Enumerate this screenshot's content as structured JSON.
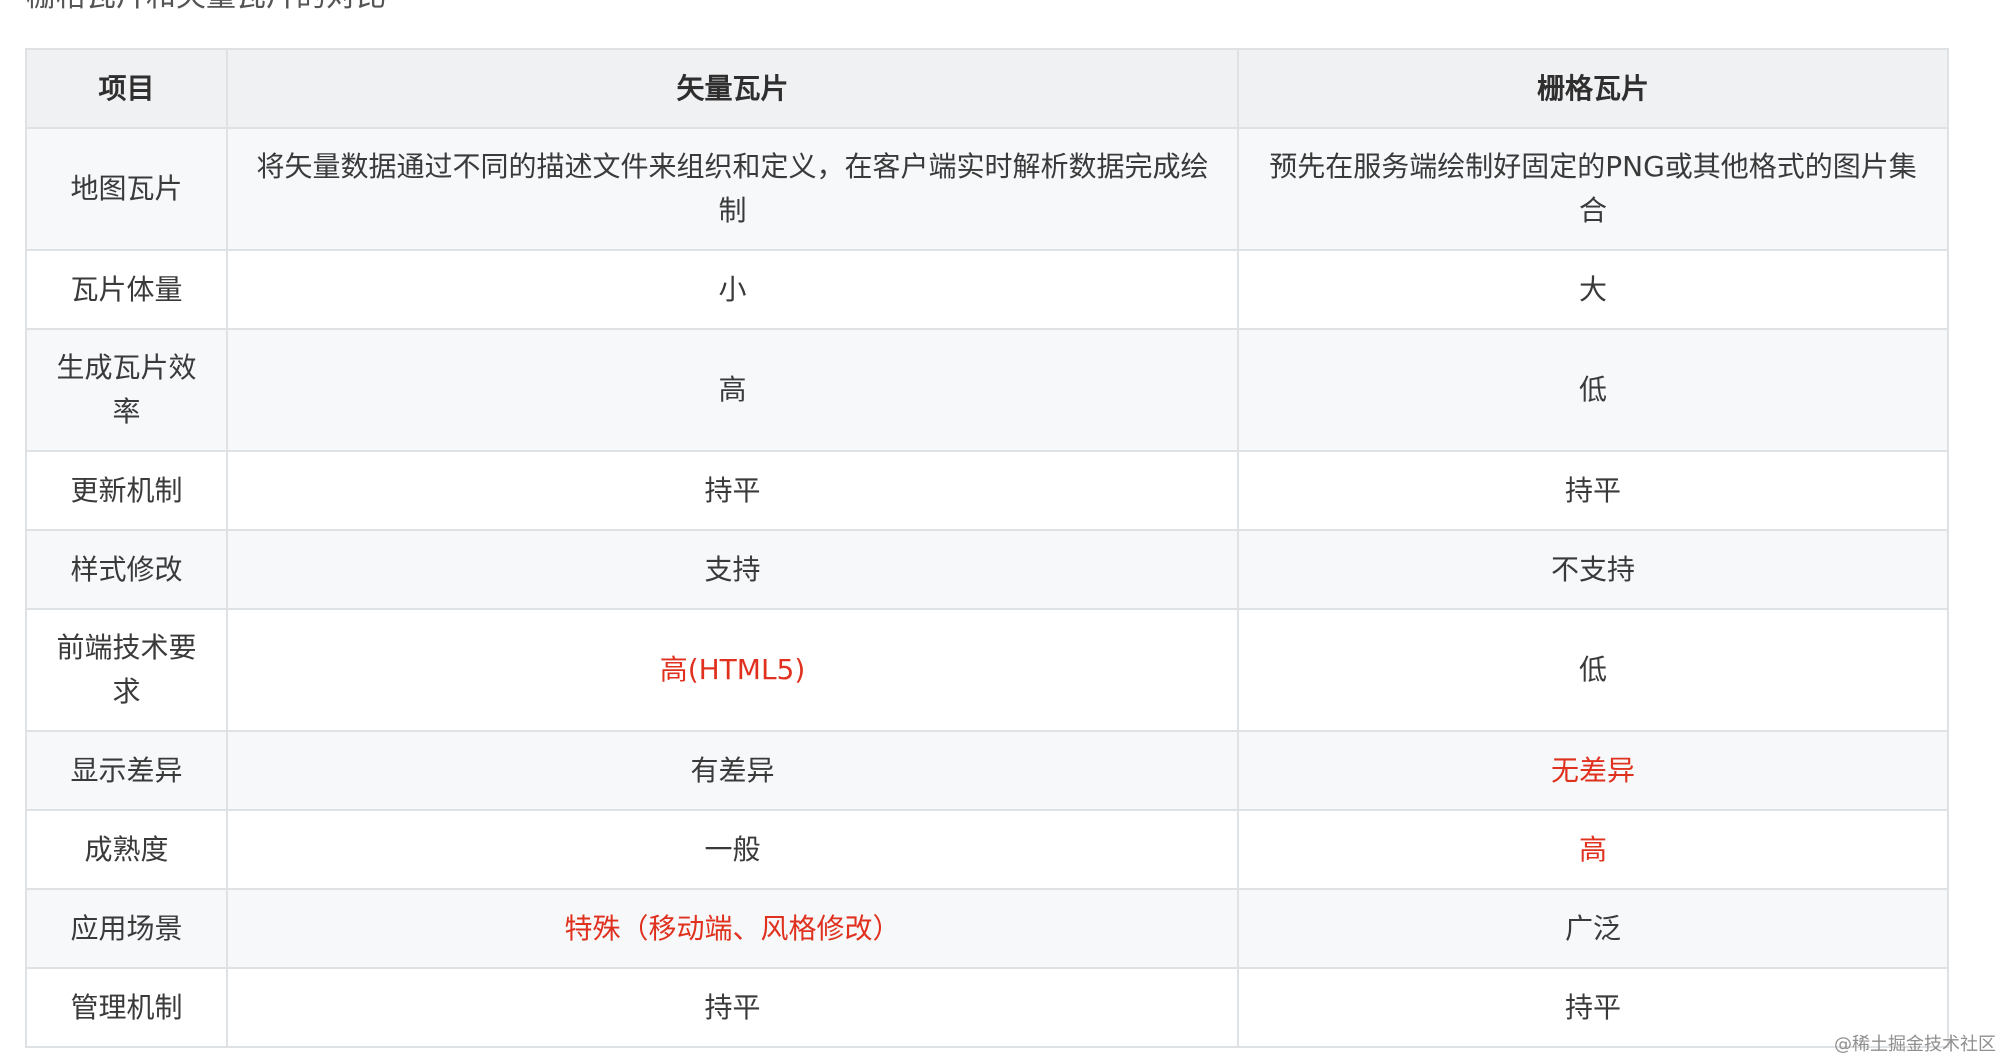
{
  "heading": "栅格瓦片和矢量瓦片的对比",
  "table": {
    "headers": [
      "项目",
      "矢量瓦片",
      "栅格瓦片"
    ],
    "rows": [
      {
        "item": "地图瓦片",
        "vector": "将矢量数据通过不同的描述文件来组织和定义，在客户端实时解析数据完成绘制",
        "raster": "预先在服务端绘制好固定的PNG或其他格式的图片集合"
      },
      {
        "item": "瓦片体量",
        "vector": "小",
        "raster": "大"
      },
      {
        "item": "生成瓦片效率",
        "vector": "高",
        "raster": "低"
      },
      {
        "item": "更新机制",
        "vector": "持平",
        "raster": "持平"
      },
      {
        "item": "样式修改",
        "vector": "支持",
        "raster": "不支持"
      },
      {
        "item": "前端技术要求",
        "vector": "高(HTML5)",
        "raster": "低"
      },
      {
        "item": "显示差异",
        "vector": "有差异",
        "raster": "无差异"
      },
      {
        "item": "成熟度",
        "vector": "一般",
        "raster": "高"
      },
      {
        "item": "应用场景",
        "vector": "特殊（移动端、风格修改）",
        "raster": "广泛"
      },
      {
        "item": "管理机制",
        "vector": "持平",
        "raster": "持平"
      }
    ]
  },
  "highlight_color": "#e0311f",
  "watermark": "@稀土掘金技术社区"
}
